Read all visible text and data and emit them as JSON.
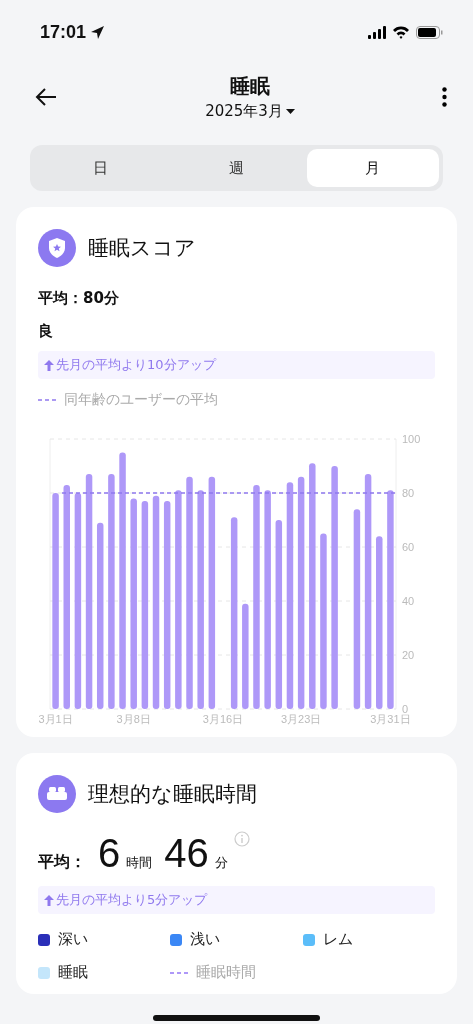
{
  "status_bar": {
    "time": "17:01"
  },
  "header": {
    "title": "睡眠",
    "period": "2025年3月"
  },
  "tabs": [
    {
      "label": "日",
      "selected": false
    },
    {
      "label": "週",
      "selected": false
    },
    {
      "label": "月",
      "selected": true
    }
  ],
  "score_card": {
    "title": "睡眠スコア",
    "average": "平均：80分",
    "rating": "良",
    "comparison": "先月の平均より10分アップ",
    "chart_data": {
      "type": "bar",
      "categories": [
        "3月1日",
        null,
        null,
        null,
        null,
        null,
        null,
        "3月8日",
        null,
        null,
        null,
        null,
        null,
        null,
        null,
        "3月16日",
        null,
        null,
        null,
        null,
        null,
        null,
        "3月23日",
        null,
        null,
        null,
        null,
        null,
        null,
        null,
        "3月31日"
      ],
      "series": [
        {
          "color": "#ae98f8",
          "values": [
            80,
            83,
            80,
            87,
            69,
            87,
            95,
            78,
            77,
            79,
            77,
            81,
            86,
            81,
            86,
            null,
            71,
            39,
            83,
            81,
            70,
            84,
            86,
            91,
            65,
            90,
            null,
            74,
            87,
            64,
            81
          ]
        }
      ],
      "ylim": [
        0,
        100
      ],
      "yticks": [
        0,
        20,
        40,
        60,
        80,
        100
      ],
      "grid": true,
      "ref_lines": [
        {
          "axis": "y",
          "value": 80,
          "color": "#8f78ee",
          "label": "同年齢のユーザーの平均"
        }
      ]
    }
  },
  "duration_card": {
    "title": "理想的な睡眠時間",
    "average_label": "平均：",
    "hours": "6",
    "hours_unit": "時間",
    "minutes": "46",
    "minutes_unit": "分",
    "comparison": "先月の平均より5分アップ",
    "legend": [
      {
        "kind": "swatch",
        "label": "深い",
        "color": "#2a2fb8"
      },
      {
        "kind": "swatch",
        "label": "浅い",
        "color": "#3b87f5"
      },
      {
        "kind": "swatch",
        "label": "レム",
        "color": "#5bbdf9"
      },
      {
        "kind": "swatch",
        "label": "睡眠",
        "color": "#c4e6fb"
      },
      {
        "kind": "dashed",
        "label": "睡眠時間",
        "color": "#ae98f8"
      }
    ]
  }
}
